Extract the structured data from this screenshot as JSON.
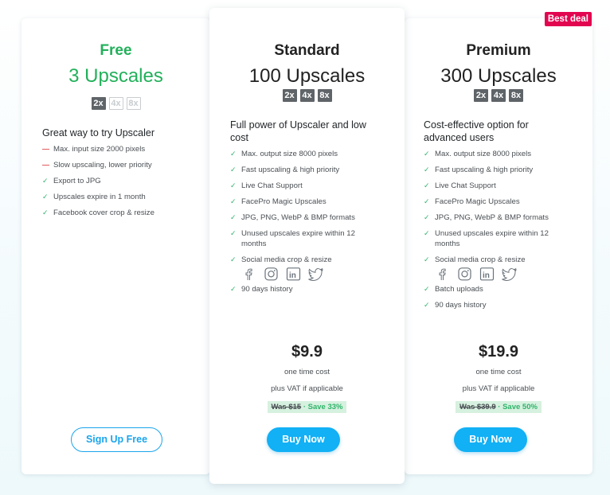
{
  "badge": "Best deal",
  "plans": {
    "free": {
      "name": "Free",
      "count": "3 Upscales",
      "scales": [
        "2x",
        "4x",
        "8x"
      ],
      "description": "Great way to try Upscaler",
      "features": [
        "Max. input size 2000 pixels",
        "Slow upscaling, lower priority",
        "Export to JPG",
        "Upscales expire in 1 month",
        "Facebook cover crop & resize"
      ],
      "button": "Sign Up Free"
    },
    "standard": {
      "name": "Standard",
      "count": "100 Upscales",
      "scales": [
        "2x",
        "4x",
        "8x"
      ],
      "description": "Full power of Upscaler and low cost",
      "features": [
        "Max. output size 8000 pixels",
        "Fast upscaling & high priority",
        "Live Chat Support",
        "FacePro Magic Upscales",
        "JPG, PNG, WebP & BMP formats",
        "Unused upscales expire within 12 months",
        "Social media crop & resize",
        "90 days history"
      ],
      "price": "$9.9",
      "cost_note": "one time cost",
      "vat_note": "plus VAT if applicable",
      "was": "Was $15",
      "save": " · Save 33%",
      "button": "Buy Now"
    },
    "premium": {
      "name": "Premium",
      "count": "300 Upscales",
      "scales": [
        "2x",
        "4x",
        "8x"
      ],
      "description": "Cost-effective option for advanced users",
      "features": [
        "Max. output size 8000 pixels",
        "Fast upscaling & high priority",
        "Live Chat Support",
        "FacePro Magic Upscales",
        "JPG, PNG, WebP & BMP formats",
        "Unused upscales expire within 12 months",
        "Social media crop & resize",
        "Batch uploads",
        "90 days history"
      ],
      "price": "$19.9",
      "cost_note": "one time cost",
      "vat_note": "plus VAT if applicable",
      "was": "Was $39.9",
      "save": " · Save 50%",
      "button": "Buy Now"
    }
  },
  "social_icons": [
    "facebook-icon",
    "instagram-icon",
    "linkedin-icon",
    "twitter-icon"
  ],
  "colors": {
    "accent": "#12b0f5",
    "free": "#22b05a",
    "check": "#2fb46a",
    "dash": "#e05050",
    "badge": "#e2054f"
  }
}
